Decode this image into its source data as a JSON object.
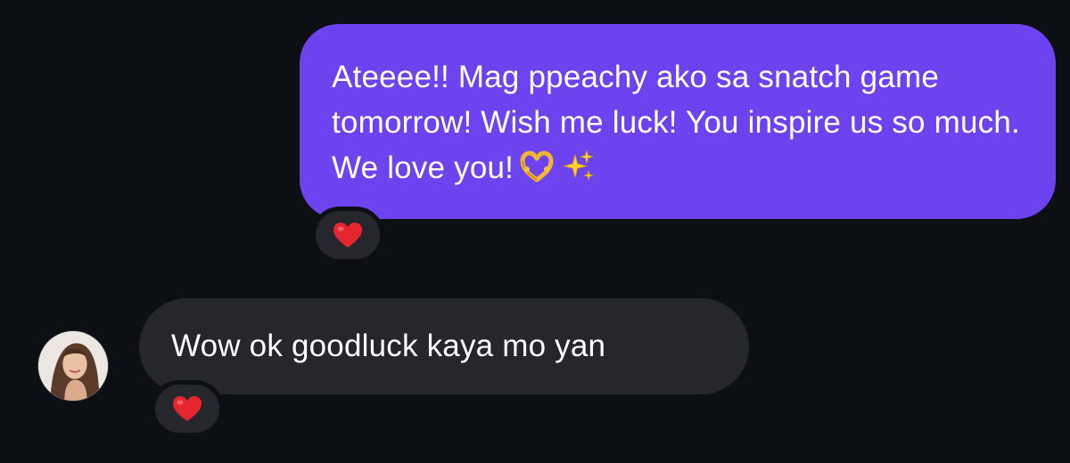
{
  "conversation": {
    "messages": [
      {
        "direction": "outgoing",
        "text": "Ateeee!! Mag ppeachy ako sa snatch game tomorrow! Wish me luck! You inspire us so much. We love you!",
        "emojis": [
          "heart-hands-emoji",
          "sparkles-emoji"
        ],
        "reaction": "❤️"
      },
      {
        "direction": "incoming",
        "text": "Wow ok goodluck kaya mo yan",
        "reaction": "❤️"
      }
    ]
  },
  "colors": {
    "background": "#0c0f14",
    "sent_bubble": "#6d43f0",
    "received_bubble": "#25272c",
    "text": "#ffffff",
    "reaction_heart": "#e5262f"
  },
  "icons": {
    "reaction": "red-heart-icon",
    "avatar": "contact-avatar"
  }
}
